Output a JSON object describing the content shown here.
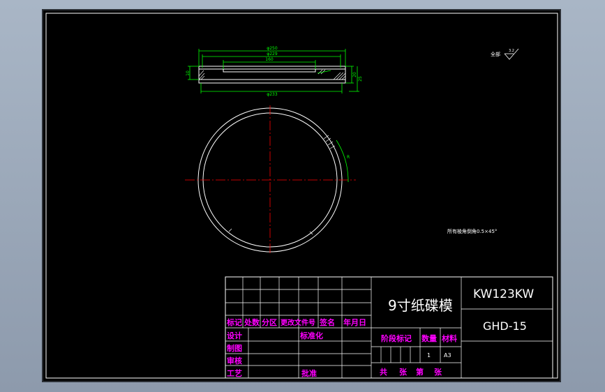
{
  "drawing": {
    "dimensions": {
      "d250": "φ250",
      "d229": "φ229",
      "d160": "160",
      "d233": "φ233",
      "h10": "10",
      "h20": "20",
      "h25": "25",
      "r": "R"
    },
    "roughness": {
      "label": "全部",
      "value": "3.2"
    },
    "chamfer_note": "所有棱角倒角0.5×45°"
  },
  "title_block": {
    "name": "9寸纸碟模",
    "code": "KW123KW",
    "drawing_no": "GHD-15",
    "headers": [
      "标记",
      "处数",
      "分区",
      "更改文件号",
      "签名",
      "年月日"
    ],
    "roles": [
      "设计",
      "制图",
      "审核",
      "工艺"
    ],
    "standardization": "标准化",
    "approval": "批准",
    "stage_headers": [
      "阶段标记",
      "数量",
      "材料"
    ],
    "quantity": "1",
    "material": "A3",
    "sheet_info": [
      "共",
      "张",
      "第",
      "张"
    ]
  },
  "colors": {
    "sheet": "#000000",
    "line": "#ffffff",
    "dimension": "#00ff00",
    "center_line": "#ff0000",
    "annotation": "#ff00ff"
  }
}
